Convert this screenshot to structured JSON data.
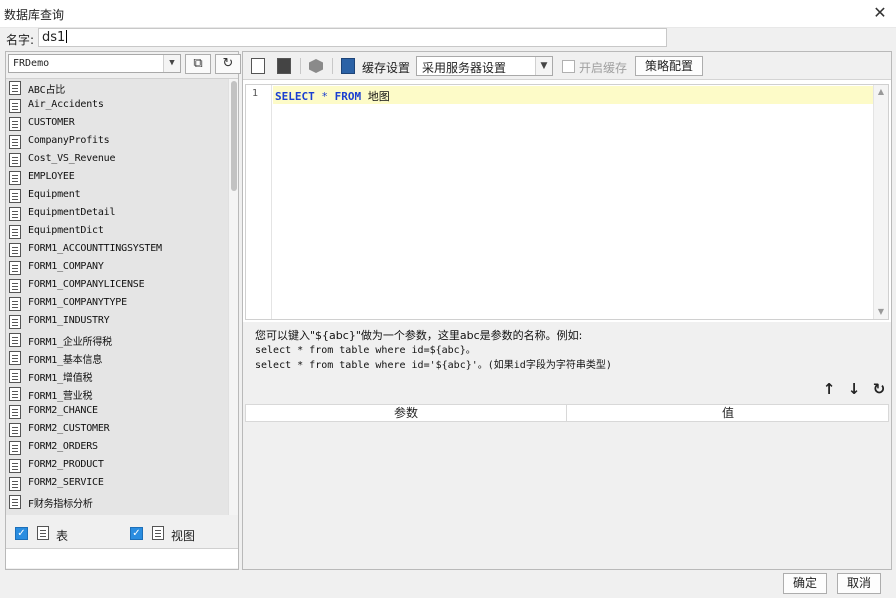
{
  "window": {
    "title": "数据库查询",
    "close_glyph": "✕"
  },
  "name_field": {
    "label": "名字:",
    "value": "ds1"
  },
  "connection": {
    "selected": "FRDemo"
  },
  "tables": [
    "ABC占比",
    "Air_Accidents",
    "CUSTOMER",
    "CompanyProfits",
    "Cost_VS_Revenue",
    "EMPLOYEE",
    "Equipment",
    "EquipmentDetail",
    "EquipmentDict",
    "FORM1_ACCOUNTTINGSYSTEM",
    "FORM1_COMPANY",
    "FORM1_COMPANYLICENSE",
    "FORM1_COMPANYTYPE",
    "FORM1_INDUSTRY",
    "FORM1_企业所得税",
    "FORM1_基本信息",
    "FORM1_增值税",
    "FORM1_营业税",
    "FORM2_CHANCE",
    "FORM2_CUSTOMER",
    "FORM2_ORDERS",
    "FORM2_PRODUCT",
    "FORM2_SERVICE",
    "F财务指标分析"
  ],
  "filters": {
    "table_label": "表",
    "view_label": "视图",
    "table_checked": true,
    "view_checked": true
  },
  "toolbar": {
    "cache_label": "缓存设置",
    "cache_mode": "采用服务器设置",
    "enable_cache_label": "开启缓存",
    "strategy_button": "策略配置"
  },
  "editor": {
    "line_number": "1",
    "kw_select": "SELECT",
    "star": "*",
    "kw_from": "FROM",
    "table_name": "地图"
  },
  "hint": {
    "line1": "您可以键入\"${abc}\"做为一个参数，这里abc是参数的名称。例如:",
    "line2": "select * from table where id=${abc}。",
    "line3": "select * from table where id='${abc}'。(如果id字段为字符串类型)"
  },
  "params": {
    "col_param": "参数",
    "col_value": "值"
  },
  "footer": {
    "ok": "确定",
    "cancel": "取消"
  },
  "colors": {
    "accent": "#2a8de0",
    "keyword": "#1a3fd1",
    "current_line": "#fdfbc8"
  }
}
